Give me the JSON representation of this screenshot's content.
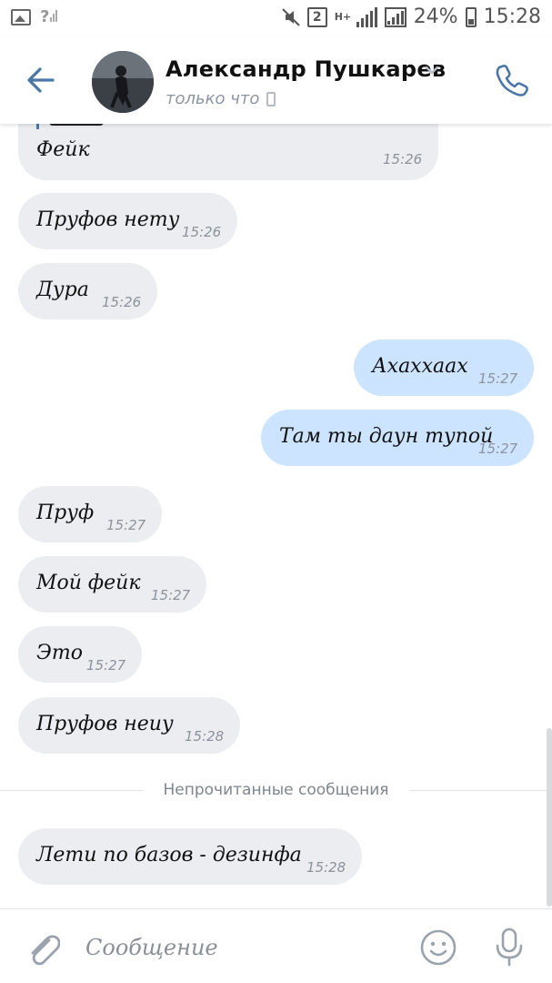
{
  "status_bar": {
    "badge": "2",
    "network": "H+",
    "sim_unknown": "?",
    "battery": "24%",
    "time": "15:28"
  },
  "header": {
    "name": "Александр Пушкарев",
    "status": "только что"
  },
  "messages": [
    {
      "dir": "in",
      "text": "Фейк",
      "time": "15:26"
    },
    {
      "dir": "in",
      "text": "Пруфов нету",
      "time": "15:26"
    },
    {
      "dir": "in",
      "text": "Дура",
      "time": "15:26"
    },
    {
      "dir": "out",
      "text": "Ахаххаах",
      "time": "15:27"
    },
    {
      "dir": "out",
      "text": "Там ты даун тупой",
      "time": "15:27"
    },
    {
      "dir": "in",
      "text": "Пруф",
      "time": "15:27"
    },
    {
      "dir": "in",
      "text": "Мой фейк",
      "time": "15:27"
    },
    {
      "dir": "in",
      "text": "Это",
      "time": "15:27"
    },
    {
      "dir": "in",
      "text": "Пруфов неиу",
      "time": "15:28"
    },
    {
      "dir": "in",
      "text": "Лети по базов - дезинфа",
      "time": "15:28"
    }
  ],
  "unread_divider": "Непрочитанные сообщения",
  "composer": {
    "placeholder": "Сообщение"
  },
  "colors": {
    "accent": "#4a76a8",
    "incoming_bubble": "#ebedf0",
    "outgoing_bubble": "#cce4ff"
  },
  "icons": [
    "back-arrow-icon",
    "chevron-down-icon",
    "phone-icon",
    "paperclip-icon",
    "emoji-icon",
    "microphone-icon"
  ]
}
